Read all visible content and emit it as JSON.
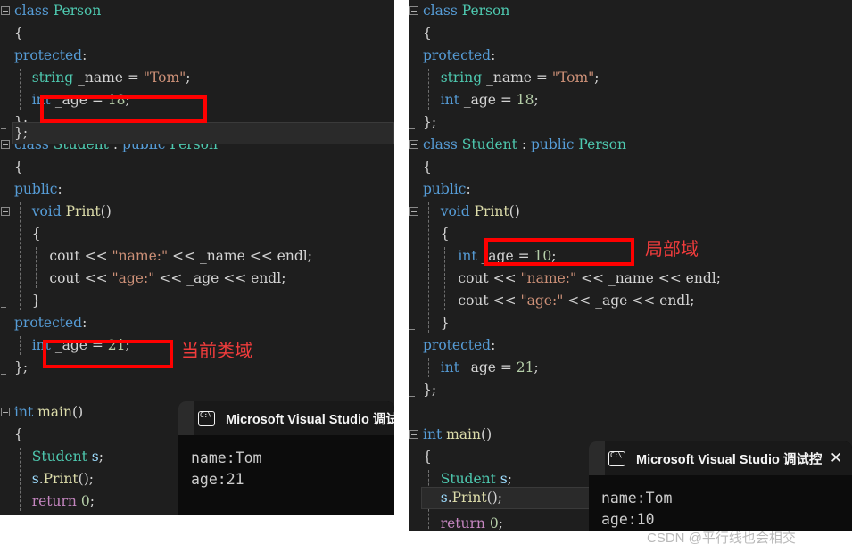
{
  "left_panel": {
    "lines": [
      {
        "t": "class Person",
        "fold": "start"
      },
      {
        "t": "{"
      },
      {
        "t": "protected:"
      },
      {
        "t": "    string _name = \"Tom\";"
      },
      {
        "t": "    int _age = 18;"
      },
      {
        "t": "};",
        "fold": "end"
      },
      {
        "t": "class Student : public Person",
        "fold": "start"
      },
      {
        "t": "{"
      },
      {
        "t": "public:"
      },
      {
        "t": "    void Print()",
        "fold": "start"
      },
      {
        "t": "    {"
      },
      {
        "t": "        cout << \"name:\" << _name << endl;"
      },
      {
        "t": "        cout << \"age:\" << _age << endl;"
      },
      {
        "t": "    }",
        "fold": "end"
      },
      {
        "t": "protected:"
      },
      {
        "t": "    int _age = 21;"
      },
      {
        "t": "};",
        "fold": "end"
      },
      {
        "t": ""
      },
      {
        "t": "int main()",
        "fold": "start"
      },
      {
        "t": "{"
      },
      {
        "t": "    Student s;"
      },
      {
        "t": "    s.Print();"
      },
      {
        "t": "    return 0;"
      }
    ],
    "annotation_label": "当前类域",
    "box_color": "#ff0000",
    "label_color": "#f03c3c"
  },
  "right_panel": {
    "lines": [
      {
        "t": "class Person",
        "fold": "start"
      },
      {
        "t": "{"
      },
      {
        "t": "protected:"
      },
      {
        "t": "    string _name = \"Tom\";"
      },
      {
        "t": "    int _age = 18;"
      },
      {
        "t": "};",
        "fold": "end"
      },
      {
        "t": "class Student : public Person",
        "fold": "start"
      },
      {
        "t": "{"
      },
      {
        "t": "public:"
      },
      {
        "t": "    void Print()",
        "fold": "start"
      },
      {
        "t": "    {"
      },
      {
        "t": "        int _age = 10;"
      },
      {
        "t": "        cout << \"name:\" << _name << endl;"
      },
      {
        "t": "        cout << \"age:\" << _age << endl;"
      },
      {
        "t": "    }",
        "fold": "end"
      },
      {
        "t": "protected:"
      },
      {
        "t": "    int _age = 21;"
      },
      {
        "t": "};",
        "fold": "end"
      },
      {
        "t": ""
      },
      {
        "t": "int main()",
        "fold": "start"
      },
      {
        "t": "{"
      },
      {
        "t": "    Student s;"
      },
      {
        "t": "    s.Print();"
      },
      {
        "t": "    return 0;"
      }
    ],
    "annotation_label": "局部域",
    "box_color": "#ff0000",
    "label_color": "#f03c3c"
  },
  "console_left": {
    "title": "Microsoft Visual Studio 调试控",
    "icon": "cmd-prompt-icon",
    "output_line1": "name:Tom",
    "output_line2": "age:21"
  },
  "console_right": {
    "title": "Microsoft Visual Studio 调试控",
    "icon": "cmd-prompt-icon",
    "close_label": "✕",
    "output_line1": "name:Tom",
    "output_line2": "age:10"
  },
  "watermark": {
    "text": "CSDN @平行线也会相交"
  }
}
